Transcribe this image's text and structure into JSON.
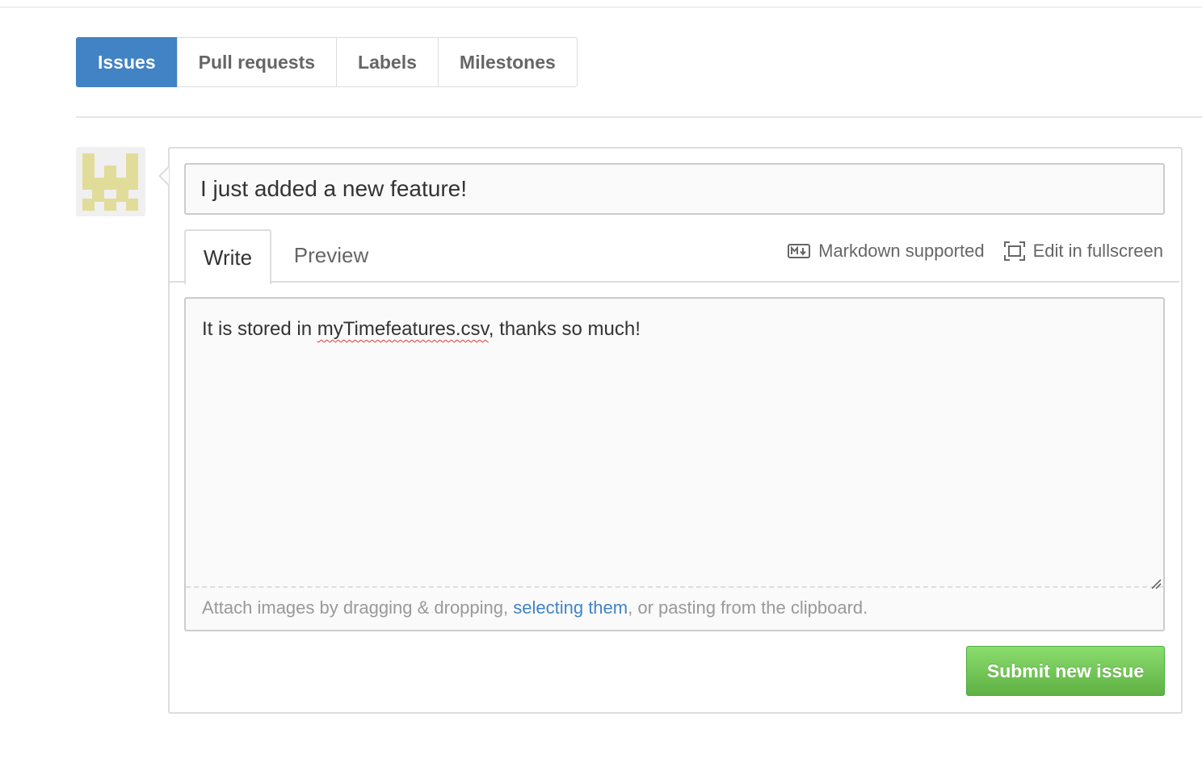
{
  "nav": {
    "tabs": [
      {
        "label": "Issues",
        "selected": true
      },
      {
        "label": "Pull requests",
        "selected": false
      },
      {
        "label": "Labels",
        "selected": false
      },
      {
        "label": "Milestones",
        "selected": false
      }
    ]
  },
  "new_issue": {
    "title_value": "I just added a new feature!",
    "tabs": {
      "write_label": "Write",
      "preview_label": "Preview"
    },
    "toolbar": {
      "markdown_label": "Markdown supported",
      "markdown_icon": "markdown-icon",
      "fullscreen_label": "Edit in fullscreen",
      "fullscreen_icon": "fullscreen-icon"
    },
    "body": {
      "before": "It is stored in ",
      "misspelled": "myTimefeatures.csv",
      "after": ", thanks so much!"
    },
    "attach": {
      "before": "Attach images by dragging & dropping, ",
      "link": "selecting them",
      "after": ", or pasting from the clipboard."
    },
    "submit_label": "Submit new issue"
  },
  "colors": {
    "accent": "#4183c4",
    "submit_green": "#6cc644",
    "avatar_tile": "#e1dc9a"
  }
}
